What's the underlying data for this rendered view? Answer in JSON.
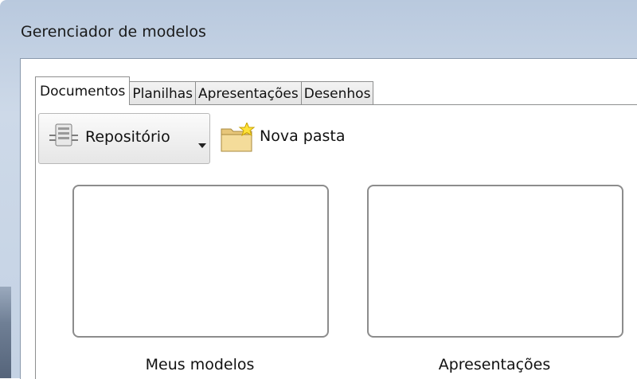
{
  "window": {
    "title": "Gerenciador de modelos"
  },
  "tabs": [
    {
      "label": "Documentos",
      "active": true
    },
    {
      "label": "Planilhas",
      "active": false
    },
    {
      "label": "Apresentações",
      "active": false
    },
    {
      "label": "Desenhos",
      "active": false
    }
  ],
  "toolbar": {
    "repository_label": "Repositório",
    "repository_icon": "repository-icon",
    "new_folder_label": "Nova pasta",
    "new_folder_icon": "new-folder-icon"
  },
  "folders": [
    {
      "label": "Meus modelos"
    },
    {
      "label": "Apresentações"
    }
  ]
}
